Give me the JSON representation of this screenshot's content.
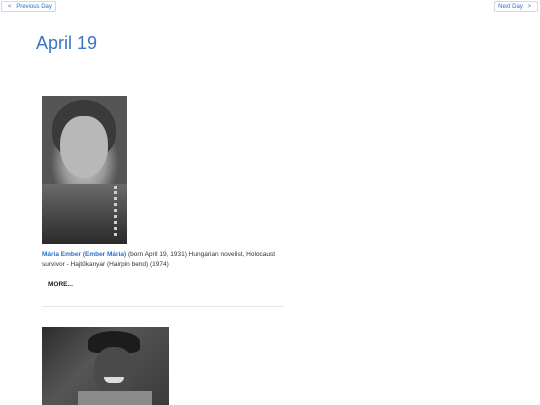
{
  "nav": {
    "prev_arrow": "<",
    "prev_label": "Previous Day",
    "next_label": "Next Day",
    "next_arrow": ">"
  },
  "page": {
    "title": "April 19"
  },
  "entries": [
    {
      "name": "Mária Ember (Ember Mária)",
      "description": " (born April 19, 1931) Hungarian novelist, Holocaust survivor - Hajtűkanyar (Hairpin bend) (1974)",
      "more_label": "MORE..."
    }
  ],
  "colors": {
    "accent": "#3a72c9",
    "link": "#2a6fcf"
  }
}
